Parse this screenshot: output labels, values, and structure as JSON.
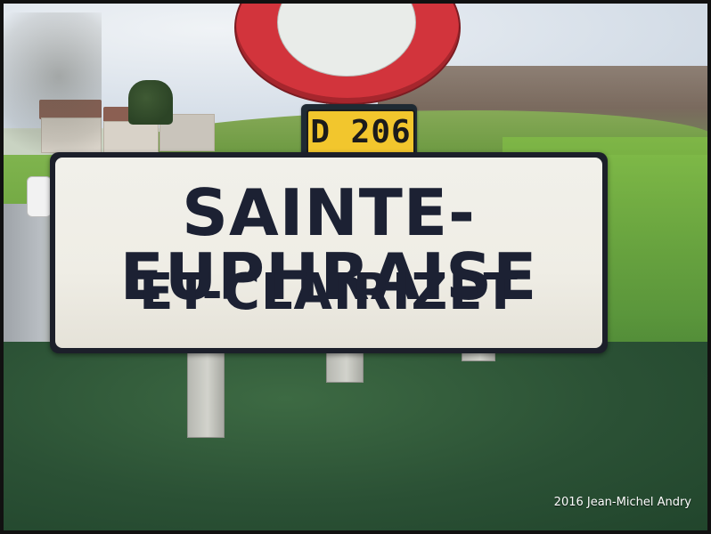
{
  "photo": {
    "signs": {
      "route_number": "D 206",
      "town_name_line_1": "SAINTE-EUPHRAISE",
      "town_name_line_2": "ET-CLAIRIZET"
    },
    "watermark": "2016 Jean-Michel Andry"
  },
  "colors": {
    "route_plate_yellow": "#f2c62d",
    "sign_text_navy": "#1c2133",
    "round_sign_red": "#d2343c"
  }
}
